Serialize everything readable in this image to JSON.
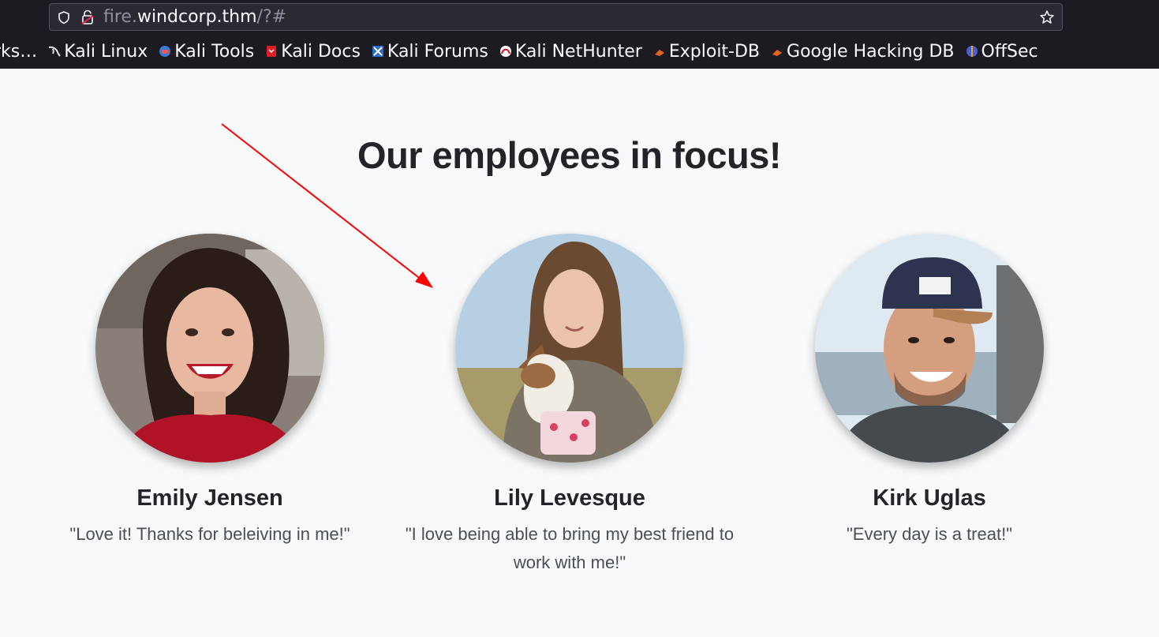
{
  "browser": {
    "url_host_prefix": "fire.",
    "url_host_main": "windcorp.thm",
    "url_path": "/?#",
    "bookmarks": [
      {
        "label": "rks…",
        "icon": "none"
      },
      {
        "label": "Kali Linux",
        "icon": "kali-dragon-icon"
      },
      {
        "label": "Kali Tools",
        "icon": "kali-tools-icon"
      },
      {
        "label": "Kali Docs",
        "icon": "kali-docs-icon"
      },
      {
        "label": "Kali Forums",
        "icon": "kali-forums-icon"
      },
      {
        "label": "Kali NetHunter",
        "icon": "kali-nethunter-icon"
      },
      {
        "label": "Exploit-DB",
        "icon": "exploit-db-icon"
      },
      {
        "label": "Google Hacking DB",
        "icon": "ghdb-icon"
      },
      {
        "label": "OffSec",
        "icon": "offsec-icon"
      }
    ]
  },
  "section": {
    "heading": "Our employees in focus!"
  },
  "employees": [
    {
      "name": "Emily Jensen",
      "quote": "\"Love it! Thanks for beleiving in me!\"",
      "photo": "emily-jensen-photo"
    },
    {
      "name": "Lily Levesque",
      "quote": "\"I love being able to bring my best friend to work with me!\"",
      "photo": "lily-levesque-photo"
    },
    {
      "name": "Kirk Uglas",
      "quote": "\"Every day is a treat!\"",
      "photo": "kirk-uglas-photo"
    }
  ],
  "annotation": {
    "color": "#ff0000",
    "icon": "red-arrow-annotation"
  }
}
